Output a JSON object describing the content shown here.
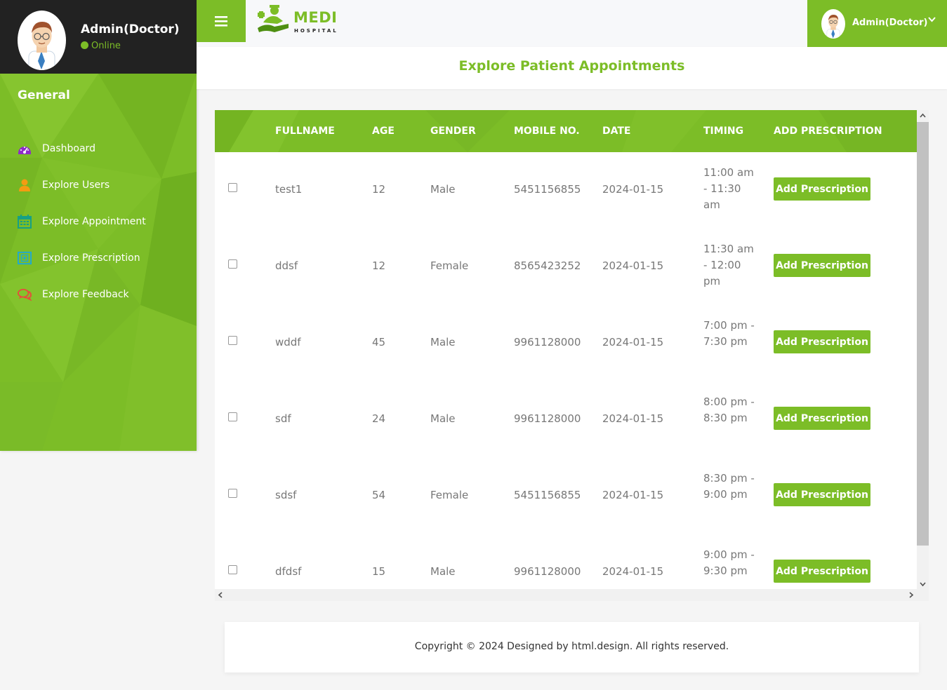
{
  "profile": {
    "name": "Admin(Doctor)",
    "status": "Online"
  },
  "sidebar": {
    "section_title": "General",
    "items": [
      {
        "label": "Dashboard",
        "icon": "dashboard-gauge-icon",
        "color": "#8e2cc9"
      },
      {
        "label": "Explore Users",
        "icon": "user-icon",
        "color": "#f39c12"
      },
      {
        "label": "Explore Appointment",
        "icon": "calendar-icon",
        "color": "#16a085"
      },
      {
        "label": "Explore Prescription",
        "icon": "prescription-icon",
        "color": "#1ba8d8"
      },
      {
        "label": "Explore Feedback",
        "icon": "comments-icon",
        "color": "#e74c3c"
      }
    ]
  },
  "header": {
    "logo_text": "MEDI",
    "logo_sub": "HOSPITAL",
    "user_name": "Admin(Doctor)"
  },
  "page": {
    "title": "Explore Patient Appointments"
  },
  "table": {
    "columns": [
      "FULLNAME",
      "AGE",
      "GENDER",
      "MOBILE NO.",
      "DATE",
      "TIMING",
      "ADD PRESCRIPTION"
    ],
    "rows": [
      {
        "fullname": "test1",
        "age": "12",
        "gender": "Male",
        "mobile": "5451156855",
        "date": "2024-01-15",
        "timing": "11:00 am - 11:30 am",
        "action": "Add Prescription"
      },
      {
        "fullname": "ddsf",
        "age": "12",
        "gender": "Female",
        "mobile": "8565423252",
        "date": "2024-01-15",
        "timing": "11:30 am - 12:00 pm",
        "action": "Add Prescription"
      },
      {
        "fullname": "wddf",
        "age": "45",
        "gender": "Male",
        "mobile": "9961128000",
        "date": "2024-01-15",
        "timing": "7:00 pm - 7:30 pm",
        "action": "Add Prescription"
      },
      {
        "fullname": "sdf",
        "age": "24",
        "gender": "Male",
        "mobile": "9961128000",
        "date": "2024-01-15",
        "timing": "8:00 pm - 8:30 pm",
        "action": "Add Prescription"
      },
      {
        "fullname": "sdsf",
        "age": "54",
        "gender": "Female",
        "mobile": "5451156855",
        "date": "2024-01-15",
        "timing": "8:30 pm - 9:00 pm",
        "action": "Add Prescription"
      },
      {
        "fullname": "dfdsf",
        "age": "15",
        "gender": "Male",
        "mobile": "9961128000",
        "date": "2024-01-15",
        "timing": "9:00 pm - 9:30 pm",
        "action": "Add Prescription"
      }
    ]
  },
  "footer": {
    "text": "Copyright © 2024 Designed by html.design. All rights reserved."
  },
  "colors": {
    "accent": "#7cbd27",
    "dark": "#222222"
  }
}
